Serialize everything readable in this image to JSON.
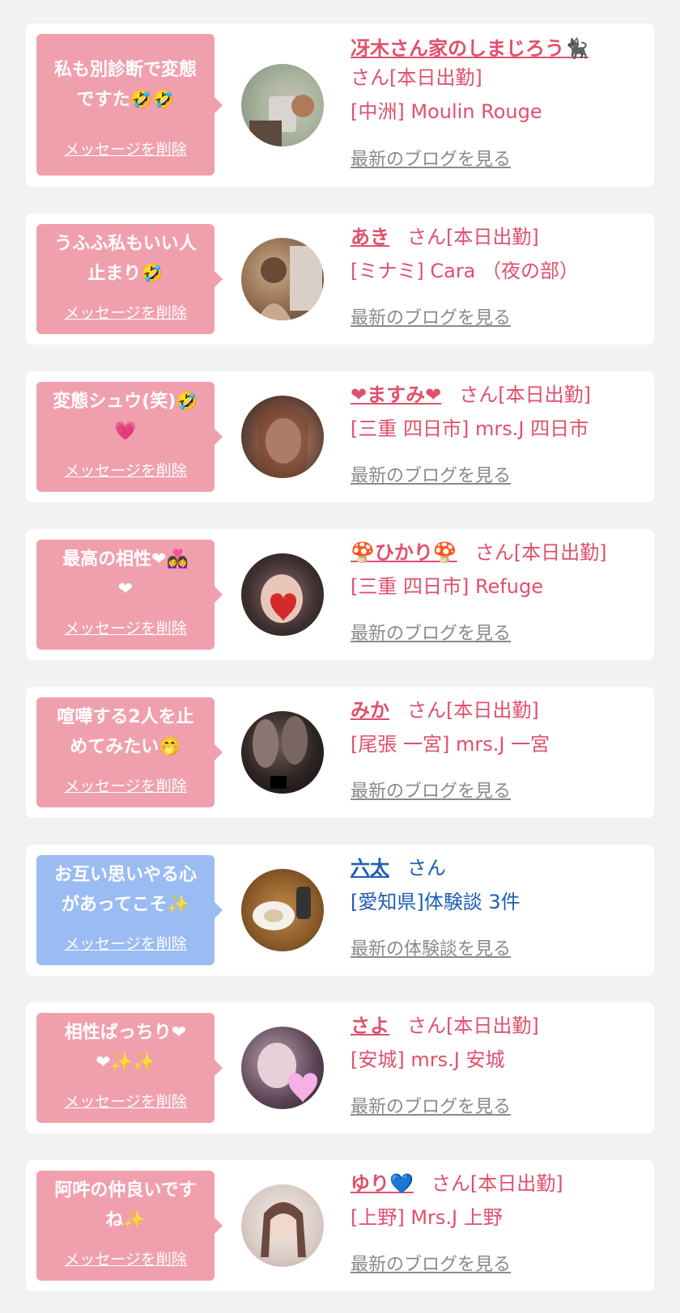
{
  "colors": {
    "pink": "#f0a0ad",
    "blue": "#9bbcf2",
    "name_pink": "#e0506c",
    "name_blue": "#1e5db3",
    "link_gray": "#8a8a8a"
  },
  "delete_label": "メッセージを削除",
  "items": [
    {
      "message_l1": "私も別診断で変態",
      "message_l2": "ですた🤣🤣",
      "name": "冴木さん家のしまじろう🐈‍⬛",
      "suffix": "さん[本日出勤]",
      "shop": "[中洲] Moulin Rouge",
      "link": "最新のブログを見る"
    },
    {
      "message_l1": "うふふ私もいい人",
      "message_l2": "止まり🤣",
      "name": "あき",
      "suffix": "さん[本日出勤]",
      "shop": "[ミナミ] Cara （夜の部）",
      "link": "最新のブログを見る"
    },
    {
      "message_l1": "変態シュウ(笑)🤣",
      "message_l2": "💗",
      "name": "❤ますみ❤",
      "suffix": "さん[本日出勤]",
      "shop": "[三重 四日市] mrs.J 四日市",
      "link": "最新のブログを見る"
    },
    {
      "message_l1": "最高の相性❤👩‍❤️‍👩",
      "message_l2": "❤",
      "name": "🍄ひかり🍄",
      "suffix": "さん[本日出勤]",
      "shop": "[三重 四日市] Refuge",
      "link": "最新のブログを見る"
    },
    {
      "message_l1": "喧嘩する2人を止",
      "message_l2": "めてみたい🤭",
      "name": "みか",
      "suffix": "さん[本日出勤]",
      "shop": "[尾張 一宮] mrs.J 一宮",
      "link": "最新のブログを見る"
    },
    {
      "message_l1": "お互い思いやる心",
      "message_l2": "があってこそ✨",
      "name": "六太",
      "suffix": "さん",
      "shop": "[愛知県]体験談 3件",
      "link": "最新の体験談を見る"
    },
    {
      "message_l1": "相性ばっちり❤",
      "message_l2": "❤✨✨",
      "name": "さよ",
      "suffix": "さん[本日出勤]",
      "shop": "[安城] mrs.J 安城",
      "link": "最新のブログを見る"
    },
    {
      "message_l1": "阿吽の仲良いです",
      "message_l2": "ね✨",
      "name": "ゆり💙",
      "suffix": "さん[本日出勤]",
      "shop": "[上野] Mrs.J 上野",
      "link": "最新のブログを見る"
    }
  ]
}
